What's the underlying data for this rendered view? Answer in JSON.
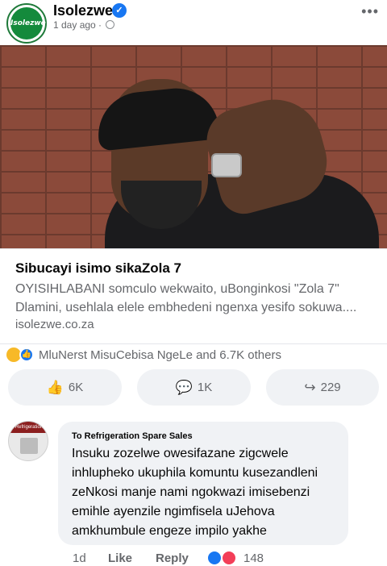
{
  "post": {
    "page_name": "Isolezwe",
    "avatar_text": "Isolezwe",
    "meta": "1 day ago ·",
    "more": "•••"
  },
  "link": {
    "title": "Sibucayi isimo sikaZola 7",
    "description": "OYISIHLABANI somculo wekwaito, uBonginkosi \"Zola 7\" Dlamini, usehlala elele embhedeni ngenxa yesifo sokuwa....",
    "domain": "isolezwe.co.za"
  },
  "reactions": {
    "summary": "MluNerst MisuCebisa NgeLe and 6.7K others"
  },
  "actions": {
    "like_count": "6K",
    "comment_count": "1K",
    "share_count": "229"
  },
  "comment": {
    "author": "To Refrigeration Spare Sales",
    "avatar_text": "Refrigeration",
    "text": "Insuku zozelwe owesifazane zigcwele inhlupheko ukuphila komuntu kusezandleni zeNkosi manje nami ngokwazi imisebenzi emihle ayenzile ngimfisela uJehova amkhumbule engeze impilo yakhe",
    "time": "1d",
    "like_label": "Like",
    "reply_label": "Reply",
    "reaction_count": "148"
  },
  "colors": {
    "accent": "#1877f2",
    "brand_green": "#148a3c",
    "secondary_text": "#65676b",
    "button_bg": "#f0f2f5"
  },
  "icons": [
    "verified-badge-icon",
    "globe-icon",
    "more-options-icon",
    "sad-reaction-icon",
    "like-reaction-icon",
    "thumbs-up-icon",
    "comment-icon",
    "share-icon",
    "love-reaction-icon"
  ]
}
